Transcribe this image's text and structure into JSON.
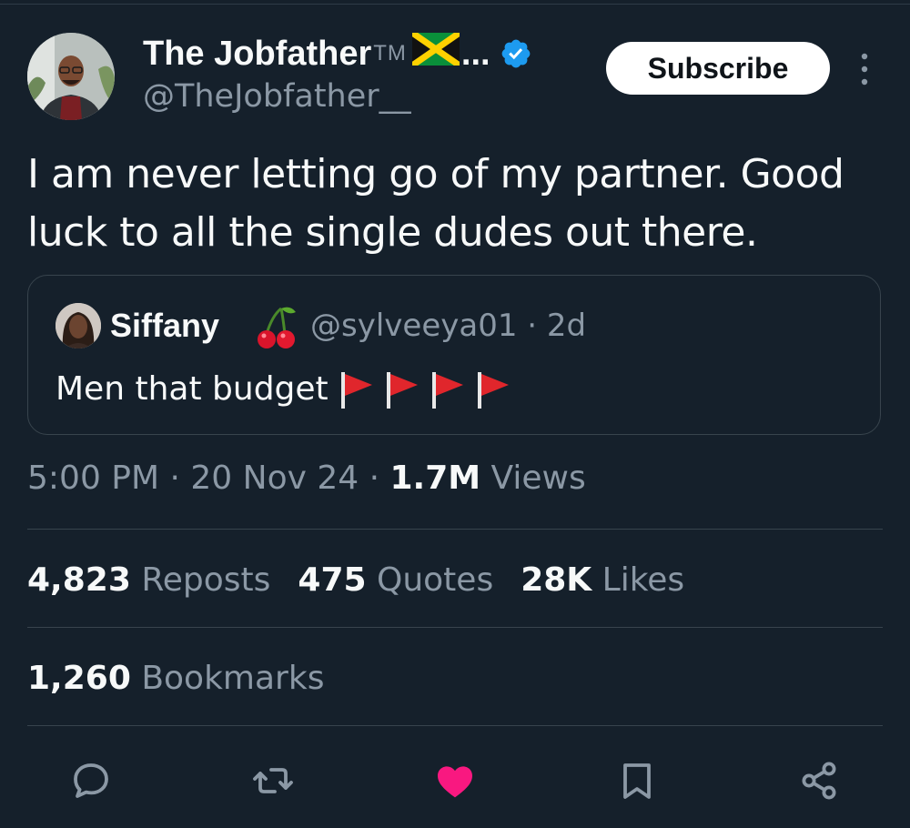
{
  "tweet": {
    "author": {
      "name": "The Jobfather",
      "tm": "TM",
      "flag_emoji": "jamaica-flag",
      "truncation": "...",
      "handle": "@TheJobfather__",
      "verified": true
    },
    "subscribe_label": "Subscribe",
    "text": "I am never letting go of my partner. Good luck to all the single dudes out there.",
    "quoted": {
      "name": "Siffany",
      "name_emoji": "cherries",
      "handle_time": "@sylveeya01 · 2d",
      "text": "Men that budget",
      "text_emoji": [
        "red-flag",
        "red-flag",
        "red-flag",
        "red-flag"
      ]
    },
    "meta": {
      "time_date": "5:00 PM · 20 Nov 24 · ",
      "views_count": "1.7M",
      "views_label": " Views"
    },
    "stats": {
      "reposts_count": "4,823",
      "reposts_label": "Reposts",
      "quotes_count": "475",
      "quotes_label": "Quotes",
      "likes_count": "28K",
      "likes_label": "Likes",
      "bookmarks_count": "1,260",
      "bookmarks_label": "Bookmarks"
    },
    "actions": [
      "reply-icon",
      "repost-icon",
      "like-icon",
      "bookmark-icon",
      "share-icon"
    ],
    "liked": true
  },
  "colors": {
    "background": "#15202b",
    "text": "#f7f9f9",
    "secondary": "#8b98a5",
    "border": "#38444d",
    "verified": "#1d9bf0",
    "like": "#f91880"
  }
}
